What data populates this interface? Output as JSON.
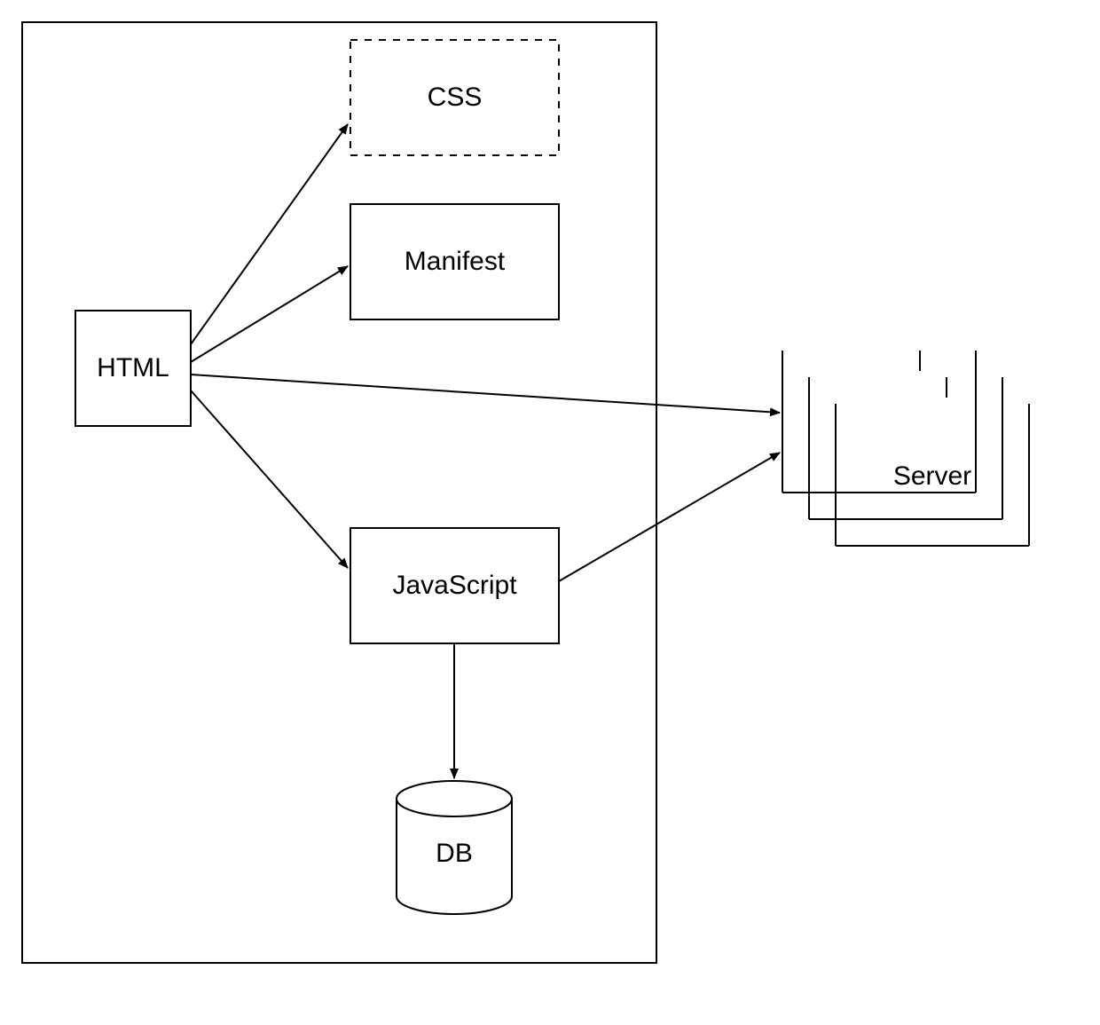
{
  "diagram": {
    "nodes": {
      "html": "HTML",
      "css": "CSS",
      "manifest": "Manifest",
      "javascript": "JavaScript",
      "db": "DB",
      "server": "Server"
    },
    "edges": [
      {
        "from": "html",
        "to": "css"
      },
      {
        "from": "html",
        "to": "manifest"
      },
      {
        "from": "html",
        "to": "javascript"
      },
      {
        "from": "html",
        "to": "server"
      },
      {
        "from": "javascript",
        "to": "server"
      },
      {
        "from": "javascript",
        "to": "db"
      }
    ],
    "description": "Web application architecture diagram showing HTML linking to CSS, Manifest, JavaScript, and Server; JavaScript connects to Server and DB. Client-side components are enclosed in a bounding box; Server is external."
  }
}
